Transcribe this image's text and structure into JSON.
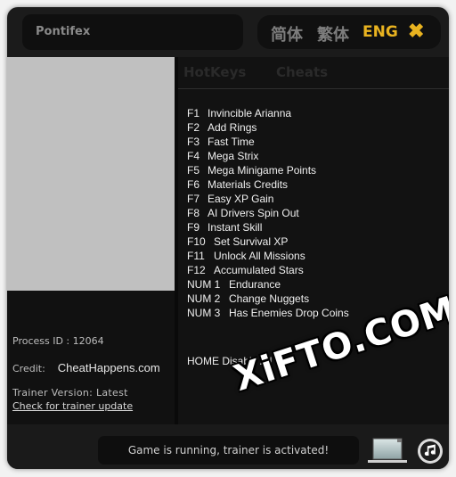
{
  "header": {
    "title": "Pontifex",
    "languages": [
      "简体",
      "繁体",
      "ENG"
    ],
    "active_language": "ENG",
    "close_glyph": "✖"
  },
  "tabs": {
    "hotkeys": "HotKeys",
    "cheats": "Cheats"
  },
  "cheats": [
    {
      "key": "F1",
      "label": "Invincible Arianna"
    },
    {
      "key": "F2",
      "label": "Add Rings"
    },
    {
      "key": "F3",
      "label": "Fast Time"
    },
    {
      "key": "F4",
      "label": "Mega Strix"
    },
    {
      "key": "F5",
      "label": "Mega Minigame Points"
    },
    {
      "key": "F6",
      "label": "Materials Credits"
    },
    {
      "key": "F7",
      "label": "Easy XP Gain"
    },
    {
      "key": "F8",
      "label": "AI Drivers Spin Out"
    },
    {
      "key": "F9",
      "label": "Instant Skill"
    },
    {
      "key": "F10",
      "label": "Set Survival XP"
    },
    {
      "key": "F11",
      "label": "Unlock All Missions"
    },
    {
      "key": "F12",
      "label": "Accumulated Stars"
    },
    {
      "key": "NUM 1",
      "label": "Endurance"
    },
    {
      "key": "NUM 2",
      "label": "Change Nuggets"
    },
    {
      "key": "NUM 3",
      "label": "Has Enemies Drop Coins"
    }
  ],
  "disable_all": {
    "key": "HOME",
    "label": "Disable All"
  },
  "info": {
    "process_id_label": "Process ID : ",
    "process_id": "12064",
    "credit_label": "Credit:",
    "credit_value": "CheatHappens.com",
    "version_label": "Trainer Version: ",
    "version_value": "Latest",
    "update_link": "Check for trainer update"
  },
  "status": {
    "message": "Game is running, trainer is activated!"
  },
  "icons": {
    "laptop": "laptop-icon",
    "music": "music-icon"
  },
  "colors": {
    "accent": "#e9b320",
    "background": "#1b1b1b",
    "panel": "#121212"
  },
  "watermark": "XiFTO.COM"
}
